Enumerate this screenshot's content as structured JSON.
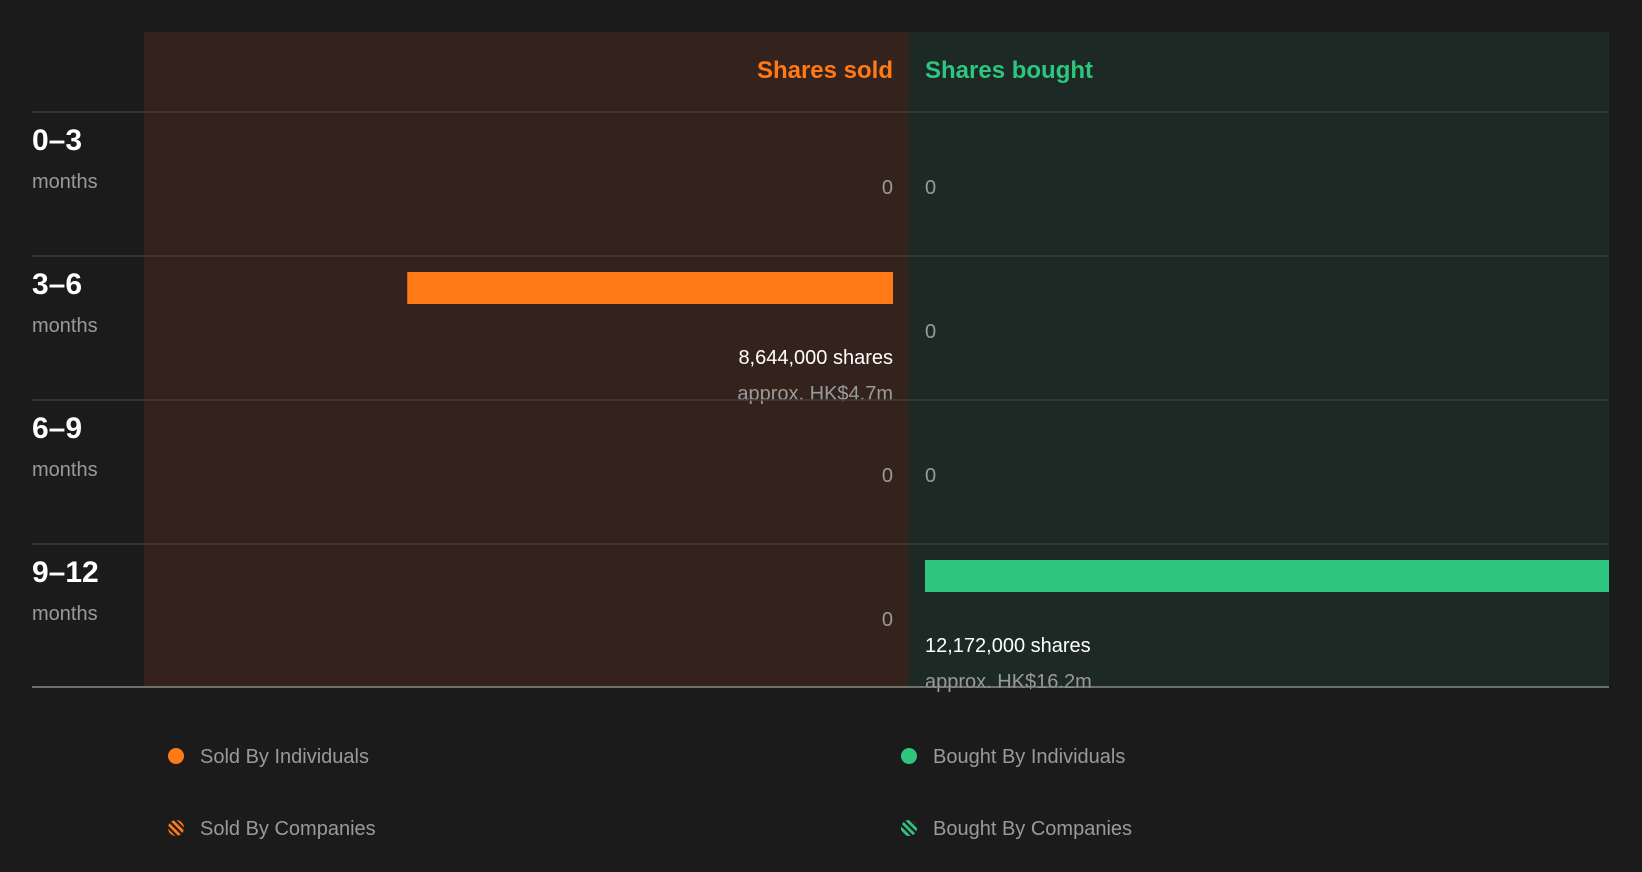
{
  "headers": {
    "sold": "Shares sold",
    "bought": "Shares bought"
  },
  "colors": {
    "sold": "#ff7a17",
    "bought": "#2ec57f",
    "sold_pane": "#33231c",
    "bought_pane": "#1c2924",
    "background": "#1b1b1b"
  },
  "chart_data": {
    "type": "bar",
    "orientation": "horizontal-diverging",
    "categories": [
      "0-3",
      "3-6",
      "6-9",
      "9-12"
    ],
    "category_unit": "months",
    "series": [
      {
        "name": "Shares sold",
        "values": [
          0,
          8644000,
          0,
          0
        ],
        "labels": [
          "0",
          "8,644,000 shares",
          "0",
          "0"
        ],
        "approx": [
          "",
          "approx. HK$4.7m",
          "",
          ""
        ]
      },
      {
        "name": "Shares bought",
        "values": [
          0,
          0,
          0,
          12172000
        ],
        "labels": [
          "0",
          "0",
          "0",
          "12,172,000 shares"
        ],
        "approx": [
          "",
          "",
          "",
          "approx. HK$16.2m"
        ]
      }
    ],
    "legend": [
      {
        "label": "Sold By Individuals",
        "style": "solid",
        "color": "#ff7a17"
      },
      {
        "label": "Bought By Individuals",
        "style": "solid",
        "color": "#2ec57f"
      },
      {
        "label": "Sold By Companies",
        "style": "striped",
        "color": "#ff7a17"
      },
      {
        "label": "Bought By Companies",
        "style": "striped",
        "color": "#2ec57f"
      }
    ],
    "legend_position": "bottom",
    "grid": false
  }
}
